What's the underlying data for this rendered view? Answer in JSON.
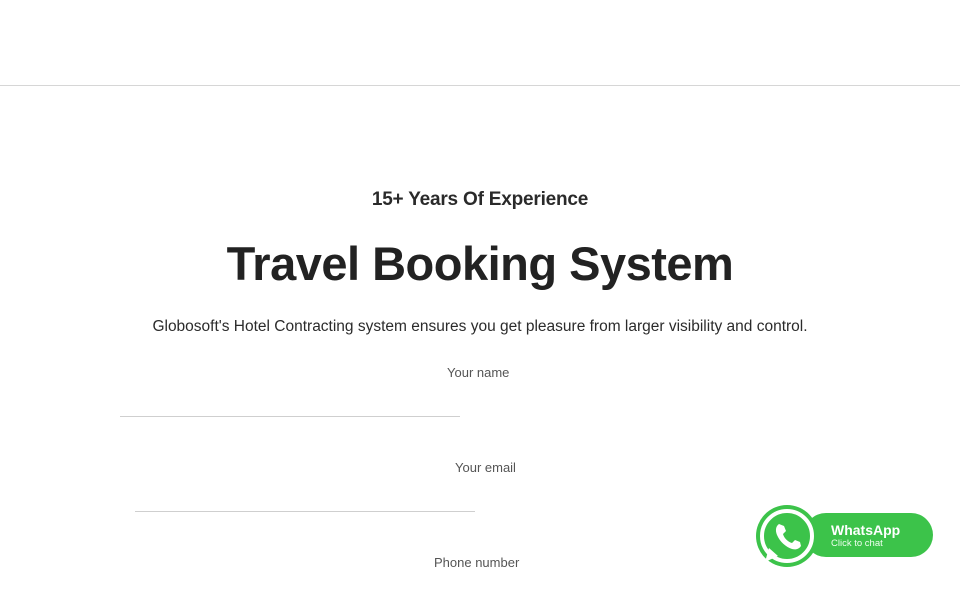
{
  "hero": {
    "eyebrow": "15+ Years Of Experience",
    "title": "Travel Booking System",
    "subtitle": "Globosoft's Hotel Contracting system ensures you get pleasure from larger visibility and control."
  },
  "form": {
    "name_label": "Your name",
    "email_label": "Your email",
    "phone_label": "Phone number",
    "name_value": "",
    "email_value": "",
    "phone_value": ""
  },
  "whatsapp": {
    "title": "WhatsApp",
    "subtitle": "Click to chat",
    "color": "#3cc34a"
  },
  "colors": {
    "accent_lines": "#c2185b",
    "text": "#222222"
  }
}
